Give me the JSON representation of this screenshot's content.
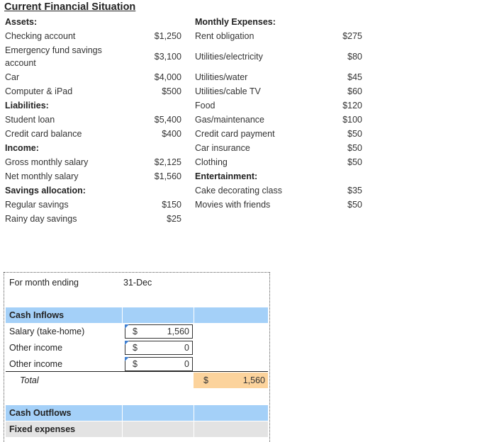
{
  "title": "Current Financial Situation",
  "left": [
    {
      "label": "Assets:",
      "header": true,
      "value": ""
    },
    {
      "label": "Checking account",
      "value": "$1,250"
    },
    {
      "label": "Emergency fund savings",
      "label2": "account",
      "value": "$3,100"
    },
    {
      "label": "Car",
      "value": "$4,000"
    },
    {
      "label": "Computer & iPad",
      "value": "$500"
    },
    {
      "label": "Liabilities:",
      "header": true,
      "value": ""
    },
    {
      "label": "Student loan",
      "value": "$5,400"
    },
    {
      "label": "Credit card balance",
      "value": "$400"
    },
    {
      "label": "Income:",
      "header": true,
      "value": ""
    },
    {
      "label": "Gross monthly salary",
      "value": "$2,125"
    },
    {
      "label": "Net monthly salary",
      "value": "$1,560"
    },
    {
      "label": "Savings allocation:",
      "header": true,
      "value": ""
    },
    {
      "label": "Regular savings",
      "value": "$150"
    },
    {
      "label": "Rainy day savings",
      "value": "$25"
    }
  ],
  "right": [
    {
      "label": "Monthly Expenses:",
      "header": true,
      "value": ""
    },
    {
      "label": "Rent obligation",
      "value": "$275"
    },
    {
      "label": "Utilities/electricity",
      "value": "$80"
    },
    {
      "label": "Utilities/water",
      "value": "$45"
    },
    {
      "label": "Utilities/cable TV",
      "value": "$60"
    },
    {
      "label": "Food",
      "value": "$120"
    },
    {
      "label": "Gas/maintenance",
      "value": "$100"
    },
    {
      "label": "Credit card payment",
      "value": "$50"
    },
    {
      "label": "Car insurance",
      "value": "$50"
    },
    {
      "label": "Clothing",
      "value": "$50"
    },
    {
      "label": "Entertainment:",
      "header": true,
      "value": ""
    },
    {
      "label": "Cake decorating class",
      "value": "$35"
    },
    {
      "label": "Movies with friends",
      "value": "$50"
    }
  ],
  "worksheet": {
    "month_label": "For month ending",
    "month_value": "31-Dec",
    "cash_inflows": "Cash Inflows",
    "inputs": [
      {
        "label": "Salary (take-home)",
        "currency": "$",
        "value": "1,560"
      },
      {
        "label": "Other income",
        "currency": "$",
        "value": "0"
      },
      {
        "label": "Other income",
        "currency": "$",
        "value": "0"
      }
    ],
    "total_label": "Total",
    "total_currency": "$",
    "total_value": "1,560",
    "cash_outflows": "Cash Outflows",
    "fixed_expenses": "Fixed expenses"
  }
}
